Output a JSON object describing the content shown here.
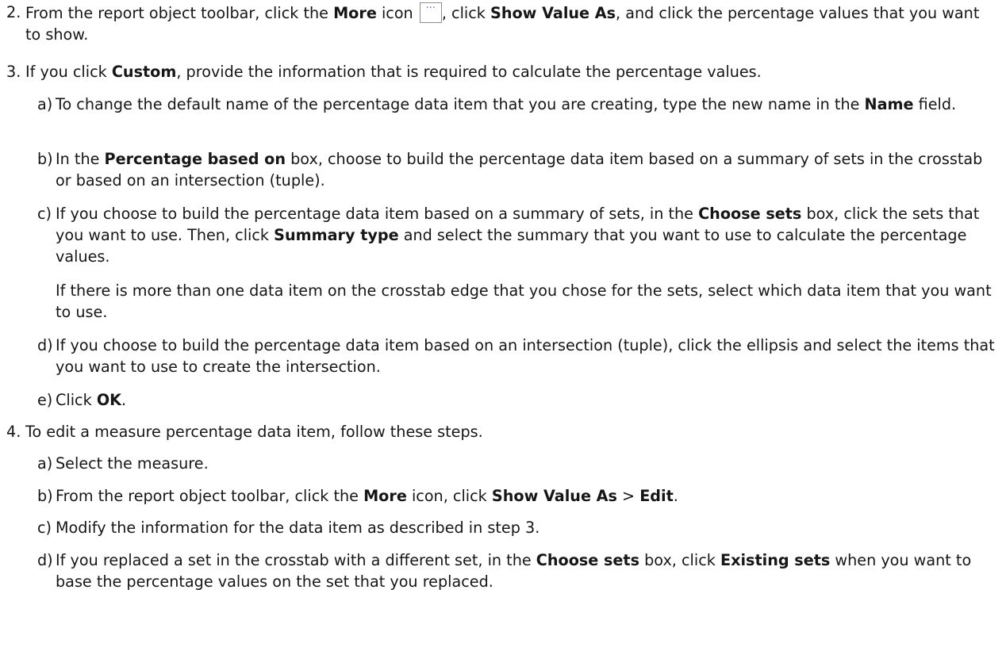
{
  "steps": [
    {
      "number": "2.",
      "parts": [
        "From the report object toolbar, click the ",
        "More",
        " icon ",
        ", click ",
        "Show Value As",
        ", and click the percentage values that you want to show."
      ],
      "icon": "more-horizontal-icon",
      "icon_glyph": "···"
    },
    {
      "number": "3.",
      "parts": [
        "If you click ",
        "Custom",
        ", provide the information that is required to calculate the percentage values."
      ],
      "substeps": [
        {
          "letter": "a)",
          "parts": [
            "To change the default name of the percentage data item that you are creating, type the new name in the ",
            "Name",
            " field."
          ]
        },
        {
          "letter": "b)",
          "parts": [
            "In the ",
            "Percentage based on",
            " box, choose to build the percentage data item based on a summary of sets in the crosstab or based on an intersection (tuple)."
          ]
        },
        {
          "letter": "c)",
          "parts": [
            "If you choose to build the percentage data item based on a summary of sets, in the ",
            "Choose sets",
            " box, click the sets that you want to use. Then, click ",
            "Summary type",
            " and select the summary that you want to use to calculate the percentage values."
          ],
          "note": "If there is more than one data item on the crosstab edge that you chose for the sets, select which data item that you want to use."
        },
        {
          "letter": "d)",
          "parts": [
            "If you choose to build the percentage data item based on an intersection (tuple), click the ellipsis and select the items that you want to use to create the intersection."
          ]
        },
        {
          "letter": "e)",
          "parts": [
            "Click ",
            "OK",
            "."
          ]
        }
      ]
    },
    {
      "number": "4.",
      "parts": [
        "To edit a measure percentage data item, follow these steps."
      ],
      "substeps": [
        {
          "letter": "a)",
          "parts": [
            "Select the measure."
          ]
        },
        {
          "letter": "b)",
          "parts": [
            "From the report object toolbar, click the ",
            "More",
            " icon, click ",
            "Show Value As",
            " > ",
            "Edit",
            "."
          ]
        },
        {
          "letter": "c)",
          "parts": [
            "Modify the information for the data item as described in step 3."
          ]
        },
        {
          "letter": "d)",
          "parts": [
            "If you replaced a set in the crosstab with a different set, in the ",
            "Choose sets",
            " box, click ",
            "Existing sets",
            " when you want to base the percentage values on the set that you replaced."
          ]
        }
      ]
    }
  ]
}
